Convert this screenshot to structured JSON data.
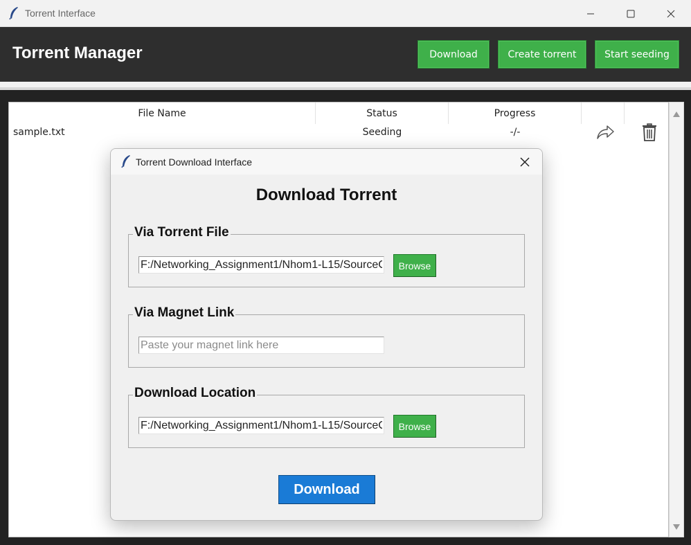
{
  "window": {
    "title": "Torrent Interface",
    "icon": "feather-icon"
  },
  "header": {
    "title": "Torrent Manager",
    "buttons": {
      "download": "Download",
      "create_torrent": "Create torrent",
      "start_seeding": "Start seeding"
    }
  },
  "table": {
    "columns": [
      "File Name",
      "Status",
      "Progress",
      "",
      ""
    ],
    "rows": [
      {
        "file_name": "sample.txt",
        "status": "Seeding",
        "progress": "-/-",
        "action_icons": [
          "share-icon",
          "trash-icon"
        ]
      }
    ]
  },
  "dialog": {
    "title": "Torrent Download Interface",
    "heading": "Download Torrent",
    "torrent_file": {
      "label": "Via Torrent File",
      "value": "F:/Networking_Assignment1/Nhom1-L15/SourceC",
      "browse_label": "Browse"
    },
    "magnet_link": {
      "label": "Via Magnet Link",
      "value": "",
      "placeholder": "Paste your magnet link here"
    },
    "download_location": {
      "label": "Download Location",
      "value": "F:/Networking_Assignment1/Nhom1-L15/SourceC",
      "browse_label": "Browse"
    },
    "download_button": "Download"
  },
  "colors": {
    "header_bg": "#2e2e2e",
    "accent_green": "#3fb04a",
    "accent_blue": "#1a7bd6"
  }
}
